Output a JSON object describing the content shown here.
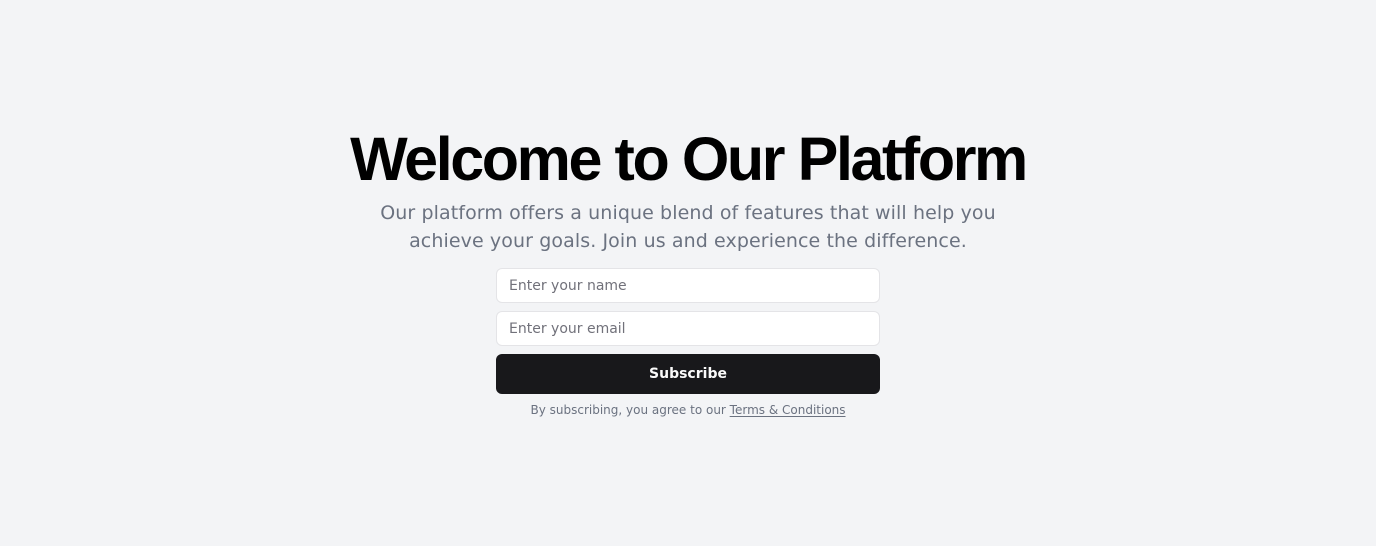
{
  "hero": {
    "title": "Welcome to Our Platform",
    "subtitle": "Our platform offers a unique blend of features that will help you achieve your goals. Join us and experience the difference."
  },
  "form": {
    "name_placeholder": "Enter your name",
    "name_value": "",
    "email_placeholder": "Enter your email",
    "email_value": "",
    "subscribe_label": "Subscribe"
  },
  "terms": {
    "prefix": "By subscribing, you agree to our ",
    "link_label": "Terms & Conditions"
  },
  "colors": {
    "background": "#f3f4f6",
    "title": "#000000",
    "muted_text": "#6b7280",
    "button_bg": "#18181b",
    "button_text": "#fafafa",
    "input_border": "#e4e4e7"
  }
}
